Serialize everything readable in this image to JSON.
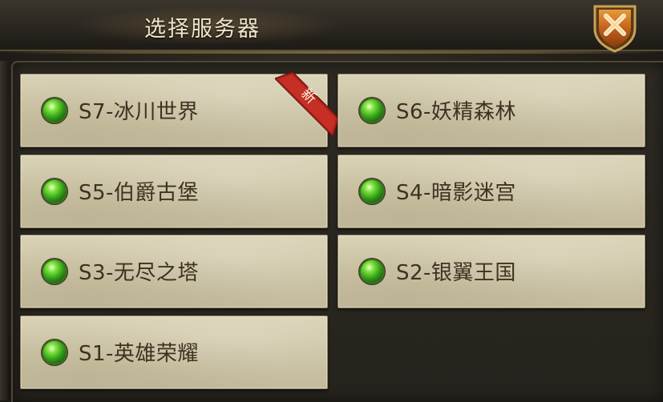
{
  "dialog": {
    "title": "选择服务器",
    "close_icon": "close-icon"
  },
  "servers": [
    {
      "label": "S7-冰川世界",
      "status": "online",
      "badge": "新"
    },
    {
      "label": "S6-妖精森林",
      "status": "online"
    },
    {
      "label": "S5-伯爵古堡",
      "status": "online"
    },
    {
      "label": "S4-暗影迷宫",
      "status": "online"
    },
    {
      "label": "S3-无尽之塔",
      "status": "online"
    },
    {
      "label": "S2-银翼王国",
      "status": "online"
    },
    {
      "label": "S1-英雄荣耀",
      "status": "online"
    }
  ],
  "colors": {
    "status_online": "#2f9b17",
    "ribbon": "#b3241c",
    "button_bg": "#cdc5a6",
    "title_text": "#f1e6cc"
  }
}
